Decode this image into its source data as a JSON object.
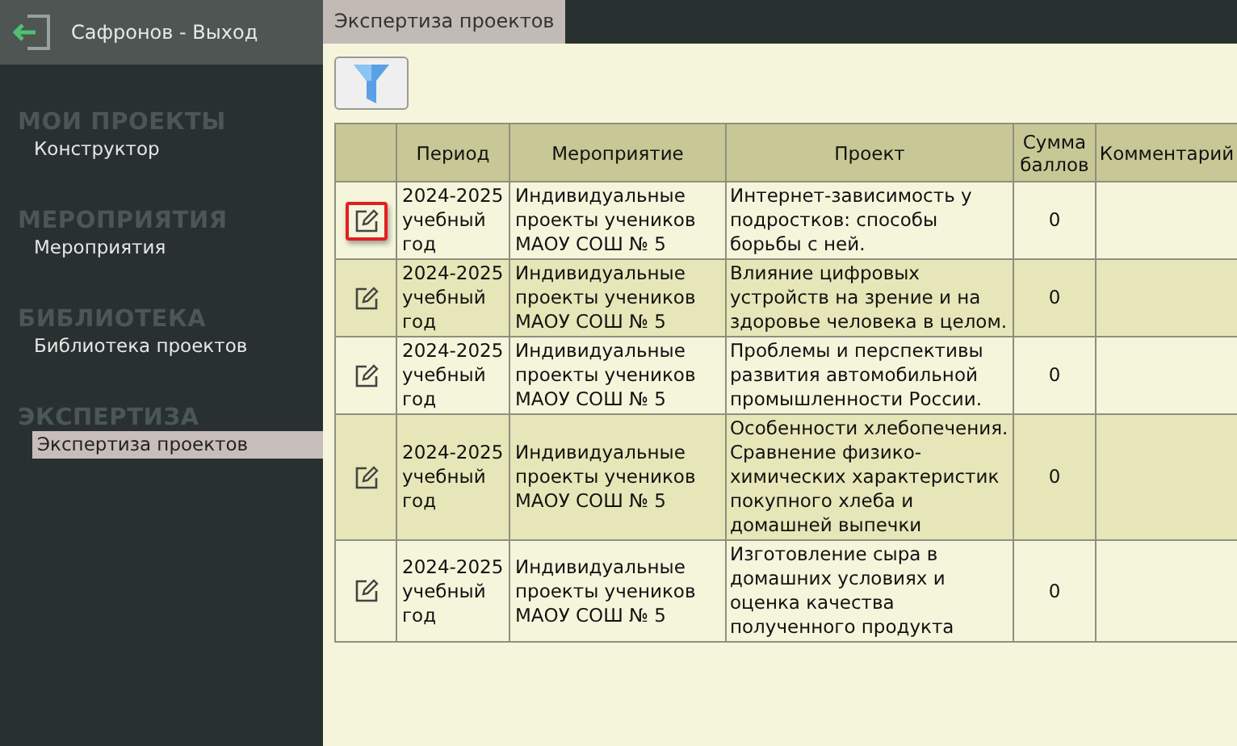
{
  "header": {
    "user_link": "Сафронов - Выход"
  },
  "sidebar": {
    "sections": [
      {
        "title": "МОИ ПРОЕКТЫ",
        "items": [
          {
            "label": "Конструктор",
            "selected": false
          }
        ]
      },
      {
        "title": "МЕРОПРИЯТИЯ",
        "items": [
          {
            "label": "Мероприятия",
            "selected": false
          }
        ]
      },
      {
        "title": "БИБЛИОТЕКА",
        "items": [
          {
            "label": "Библиотека проектов",
            "selected": false
          }
        ]
      },
      {
        "title": "ЭКСПЕРТИЗА",
        "items": [
          {
            "label": "Экспертиза проектов",
            "selected": true
          }
        ]
      }
    ]
  },
  "tabs": [
    {
      "label": "Экспертиза проектов",
      "selected": true
    }
  ],
  "table": {
    "columns": [
      "",
      "Период",
      "Мероприятие",
      "Проект",
      "Сумма баллов",
      "Комментарий"
    ],
    "rows": [
      {
        "edit_highlighted": true,
        "period": "2024-2025 учебный год",
        "event": "Индивидуальные проекты учеников МАОУ СОШ № 5",
        "project": "Интернет-зависимость у подростков: способы борьбы с ней.",
        "score": "0"
      },
      {
        "edit_highlighted": false,
        "period": "2024-2025 учебный год",
        "event": "Индивидуальные проекты учеников МАОУ СОШ № 5",
        "project": "Влияние цифровых устройств на зрение и на здоровье человека в целом.",
        "score": "0"
      },
      {
        "edit_highlighted": false,
        "period": "2024-2025 учебный год",
        "event": "Индивидуальные проекты учеников МАОУ СОШ № 5",
        "project": "Проблемы и перспективы развития автомобильной промышленности России.",
        "score": "0"
      },
      {
        "edit_highlighted": false,
        "period": "2024-2025 учебный год",
        "event": "Индивидуальные проекты учеников МАОУ СОШ № 5",
        "project": "Особенности хлебопечения. Сравнение физико-химических характеристик покупного хлеба и домашней выпечки",
        "score": "0"
      },
      {
        "edit_highlighted": false,
        "period": "2024-2025 учебный год",
        "event": "Индивидуальные проекты учеников МАОУ СОШ № 5",
        "project": "Изготовление сыра в домашних условиях и оценка качества полученного продукта",
        "score": "0"
      }
    ]
  }
}
